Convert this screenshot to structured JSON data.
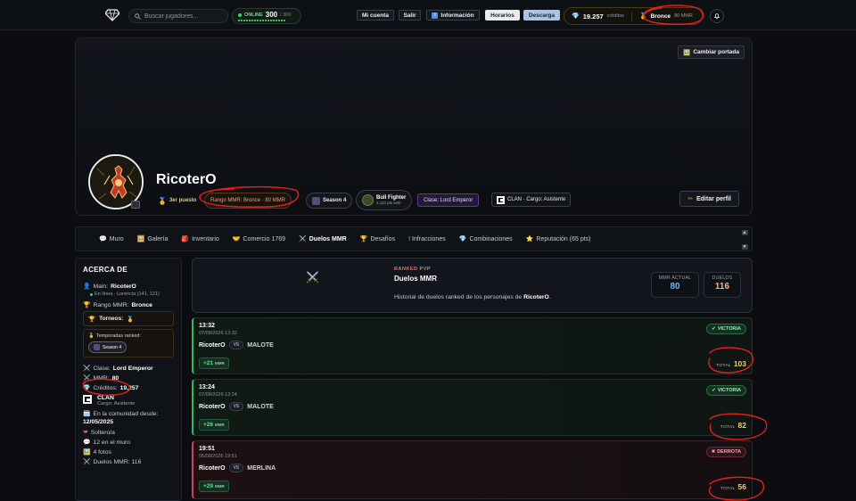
{
  "nav": {
    "search_placeholder": "Buscar jugadores...",
    "online_label": "ONLINE",
    "online_count": "300",
    "online_max": "/ 300",
    "buttons": [
      "Mi cuenta",
      "Salir",
      "Información",
      "Horarios",
      "Descarga"
    ],
    "credits_value": "19.257",
    "credits_label": "créditos",
    "rank_label": "Bronce",
    "rank_mmr": "80 MMR"
  },
  "cover": {
    "change_cover_label": "Cambiar portada",
    "username": "RicoterO",
    "edit_profile_label": "Editar perfil",
    "chips": {
      "place": "3er puesto",
      "mmr_rank": "Rango MMR: Bronce · 80 MMR",
      "season": "Season 4",
      "fighter_title": "Bull Fighter",
      "fighter_sub": "2,110 pts web",
      "class": "Clase: Lord Emperor",
      "clan": "CLAN · Cargo: Asistente"
    }
  },
  "tabs": [
    {
      "label": "Muro",
      "icon": "💬"
    },
    {
      "label": "Galería",
      "icon": "🖼️"
    },
    {
      "label": "Inventario",
      "icon": "🎒"
    },
    {
      "label": "Comercio 1769",
      "icon": "🤝"
    },
    {
      "label": "Duelos MMR",
      "icon": "⚔️"
    },
    {
      "label": "Desafíos",
      "icon": "🏆"
    },
    {
      "label": "! Infracciones",
      "icon": ""
    },
    {
      "label": "Combinaciones",
      "icon": "💎"
    },
    {
      "label": "Reputación (65 pts)",
      "icon": "⭐"
    }
  ],
  "about": {
    "title": "ACERCA DE",
    "main_label": "Main:",
    "main_value": "RicoterO",
    "main_status": "En línea · Lorencia (141, 121)",
    "rank_label": "Rango MMR:",
    "rank_value": "Bronce",
    "tournaments_label": "Torneos:",
    "ranked_seasons_label": "Temporadas ranked:",
    "season_chip": "Season 4",
    "class_label": "Clase:",
    "class_value": "Lord Emperor",
    "mmr_label": "MMR:",
    "mmr_value": "80",
    "credits_label": "Créditos:",
    "credits_value": "19,257",
    "clan_name": "CLAN",
    "clan_role": "Cargo: Asistente",
    "joined_label": "En la comunidad desde:",
    "joined_value": "12/05/2025",
    "status": "Soltero/a",
    "wall": "12 en el muro",
    "photos": "4 fotos",
    "duels": "Duelos MMR: 116"
  },
  "duels_header": {
    "kicker": "RANKED PVP",
    "title": "Duelos MMR",
    "description_pre": "Historial de duelos ranked de los personajes de ",
    "description_name": "RicoterO",
    "description_post": ".",
    "mmr_label": "MMR ACTUAL",
    "mmr_value": "80",
    "duels_label": "DUELOS",
    "duels_value": "116"
  },
  "duels": [
    {
      "time": "13:32",
      "date": "07/08/2026 13:32",
      "player": "RicoterO",
      "vs": "VS",
      "opponent": "MALOTE",
      "delta": "+21",
      "delta_unit": "MMR",
      "result": "VICTORIA",
      "total_label": "TOTAL",
      "total": "103"
    },
    {
      "time": "13:24",
      "date": "07/08/2026 13:24",
      "player": "RicoterO",
      "vs": "VS",
      "opponent": "MALOTE",
      "delta": "+26",
      "delta_unit": "MMR",
      "result": "VICTORIA",
      "total_label": "TOTAL",
      "total": "82"
    },
    {
      "time": "19:51",
      "date": "06/08/2026 19:51",
      "player": "RicoterO",
      "vs": "VS",
      "opponent": "MERLINA",
      "delta": "+29",
      "delta_unit": "MMR",
      "result": "DERROTA",
      "total_label": "TOTAL",
      "total": "56"
    }
  ],
  "colors": {
    "win": "#2fb86a",
    "lose": "#d0405a",
    "gold": "#f1d36a",
    "accent_blue": "#6cb6ff"
  }
}
